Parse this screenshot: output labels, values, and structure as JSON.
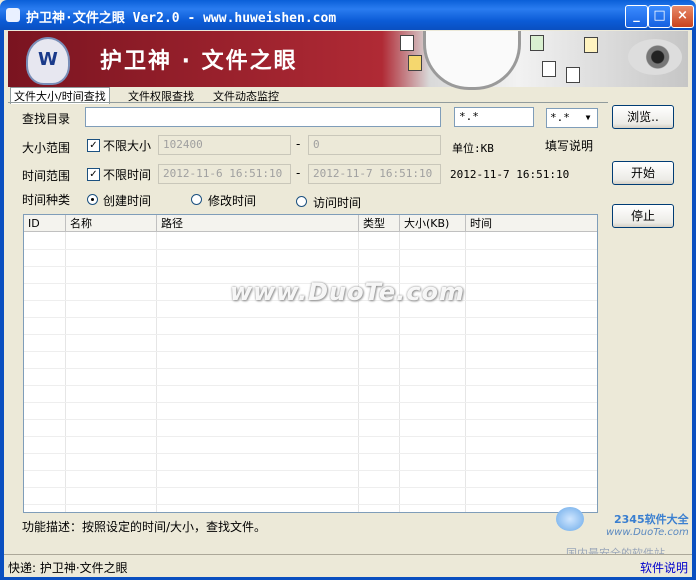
{
  "window": {
    "title": "护卫神·文件之眼 Ver2.0 - www.huweishen.com",
    "controls": [
      "_",
      "□",
      "×"
    ]
  },
  "banner": {
    "title": "护卫神 · 文件之眼",
    "logo_letter": "W"
  },
  "tabs": [
    {
      "label": "文件大小/时间查找",
      "active": true
    },
    {
      "label": "文件权限查找",
      "active": false
    },
    {
      "label": "文件动态监控",
      "active": false
    }
  ],
  "form": {
    "dir_label": "查找目录",
    "dir_value": "",
    "pattern_value": "*.*",
    "pattern_select": "*.*",
    "browse_button": "浏览..",
    "size_label": "大小范围",
    "size_unlimited_label": "不限大小",
    "size_unlimited_checked": true,
    "size_min": "102400",
    "size_dash": "-",
    "size_max": "0",
    "size_unit": "单位:KB",
    "fill_help": "填写说明",
    "time_label": "时间范围",
    "time_unlimited_label": "不限时间",
    "time_unlimited_checked": true,
    "time_start": "2012-11-6 16:51:10",
    "time_dash": "-",
    "time_end": "2012-11-7 16:51:10",
    "time_now": "2012-11-7 16:51:10",
    "start_button": "开始",
    "timetype_label": "时间种类",
    "timetype_options": [
      "创建时间",
      "修改时间",
      "访问时间"
    ],
    "timetype_selected": 0,
    "stop_button": "停止"
  },
  "table": {
    "columns": [
      "ID",
      "名称",
      "路径",
      "类型",
      "大小(KB)",
      "时间"
    ],
    "rows": []
  },
  "watermark": "www.DuoTe.com",
  "description": "功能描述：按照设定的时间/大小，查找文件。",
  "status": {
    "left": "快递: 护卫神·文件之眼",
    "right_link": "软件说明"
  },
  "corner_watermark": {
    "line1": "2345软件大全",
    "line2": "www.DuoTe.com",
    "line3": "国内最安全的软件站"
  },
  "colors": {
    "titlebar": "#0a5fd8",
    "banner_red": "#b02a35",
    "dialog_bg": "#ece9d8",
    "link": "#0000cc"
  }
}
